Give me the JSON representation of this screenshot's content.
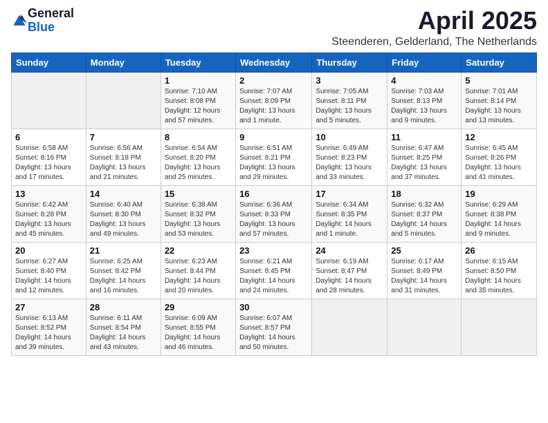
{
  "logo": {
    "general": "General",
    "blue": "Blue"
  },
  "title": "April 2025",
  "subtitle": "Steenderen, Gelderland, The Netherlands",
  "days_of_week": [
    "Sunday",
    "Monday",
    "Tuesday",
    "Wednesday",
    "Thursday",
    "Friday",
    "Saturday"
  ],
  "weeks": [
    [
      {
        "day": "",
        "info": ""
      },
      {
        "day": "",
        "info": ""
      },
      {
        "day": "1",
        "info": "Sunrise: 7:10 AM\nSunset: 8:08 PM\nDaylight: 12 hours and 57 minutes."
      },
      {
        "day": "2",
        "info": "Sunrise: 7:07 AM\nSunset: 8:09 PM\nDaylight: 13 hours and 1 minute."
      },
      {
        "day": "3",
        "info": "Sunrise: 7:05 AM\nSunset: 8:11 PM\nDaylight: 13 hours and 5 minutes."
      },
      {
        "day": "4",
        "info": "Sunrise: 7:03 AM\nSunset: 8:13 PM\nDaylight: 13 hours and 9 minutes."
      },
      {
        "day": "5",
        "info": "Sunrise: 7:01 AM\nSunset: 8:14 PM\nDaylight: 13 hours and 13 minutes."
      }
    ],
    [
      {
        "day": "6",
        "info": "Sunrise: 6:58 AM\nSunset: 8:16 PM\nDaylight: 13 hours and 17 minutes."
      },
      {
        "day": "7",
        "info": "Sunrise: 6:56 AM\nSunset: 8:18 PM\nDaylight: 13 hours and 21 minutes."
      },
      {
        "day": "8",
        "info": "Sunrise: 6:54 AM\nSunset: 8:20 PM\nDaylight: 13 hours and 25 minutes."
      },
      {
        "day": "9",
        "info": "Sunrise: 6:51 AM\nSunset: 8:21 PM\nDaylight: 13 hours and 29 minutes."
      },
      {
        "day": "10",
        "info": "Sunrise: 6:49 AM\nSunset: 8:23 PM\nDaylight: 13 hours and 33 minutes."
      },
      {
        "day": "11",
        "info": "Sunrise: 6:47 AM\nSunset: 8:25 PM\nDaylight: 13 hours and 37 minutes."
      },
      {
        "day": "12",
        "info": "Sunrise: 6:45 AM\nSunset: 8:26 PM\nDaylight: 13 hours and 41 minutes."
      }
    ],
    [
      {
        "day": "13",
        "info": "Sunrise: 6:42 AM\nSunset: 8:28 PM\nDaylight: 13 hours and 45 minutes."
      },
      {
        "day": "14",
        "info": "Sunrise: 6:40 AM\nSunset: 8:30 PM\nDaylight: 13 hours and 49 minutes."
      },
      {
        "day": "15",
        "info": "Sunrise: 6:38 AM\nSunset: 8:32 PM\nDaylight: 13 hours and 53 minutes."
      },
      {
        "day": "16",
        "info": "Sunrise: 6:36 AM\nSunset: 8:33 PM\nDaylight: 13 hours and 57 minutes."
      },
      {
        "day": "17",
        "info": "Sunrise: 6:34 AM\nSunset: 8:35 PM\nDaylight: 14 hours and 1 minute."
      },
      {
        "day": "18",
        "info": "Sunrise: 6:32 AM\nSunset: 8:37 PM\nDaylight: 14 hours and 5 minutes."
      },
      {
        "day": "19",
        "info": "Sunrise: 6:29 AM\nSunset: 8:38 PM\nDaylight: 14 hours and 9 minutes."
      }
    ],
    [
      {
        "day": "20",
        "info": "Sunrise: 6:27 AM\nSunset: 8:40 PM\nDaylight: 14 hours and 12 minutes."
      },
      {
        "day": "21",
        "info": "Sunrise: 6:25 AM\nSunset: 8:42 PM\nDaylight: 14 hours and 16 minutes."
      },
      {
        "day": "22",
        "info": "Sunrise: 6:23 AM\nSunset: 8:44 PM\nDaylight: 14 hours and 20 minutes."
      },
      {
        "day": "23",
        "info": "Sunrise: 6:21 AM\nSunset: 8:45 PM\nDaylight: 14 hours and 24 minutes."
      },
      {
        "day": "24",
        "info": "Sunrise: 6:19 AM\nSunset: 8:47 PM\nDaylight: 14 hours and 28 minutes."
      },
      {
        "day": "25",
        "info": "Sunrise: 6:17 AM\nSunset: 8:49 PM\nDaylight: 14 hours and 31 minutes."
      },
      {
        "day": "26",
        "info": "Sunrise: 6:15 AM\nSunset: 8:50 PM\nDaylight: 14 hours and 35 minutes."
      }
    ],
    [
      {
        "day": "27",
        "info": "Sunrise: 6:13 AM\nSunset: 8:52 PM\nDaylight: 14 hours and 39 minutes."
      },
      {
        "day": "28",
        "info": "Sunrise: 6:11 AM\nSunset: 8:54 PM\nDaylight: 14 hours and 43 minutes."
      },
      {
        "day": "29",
        "info": "Sunrise: 6:09 AM\nSunset: 8:55 PM\nDaylight: 14 hours and 46 minutes."
      },
      {
        "day": "30",
        "info": "Sunrise: 6:07 AM\nSunset: 8:57 PM\nDaylight: 14 hours and 50 minutes."
      },
      {
        "day": "",
        "info": ""
      },
      {
        "day": "",
        "info": ""
      },
      {
        "day": "",
        "info": ""
      }
    ]
  ]
}
